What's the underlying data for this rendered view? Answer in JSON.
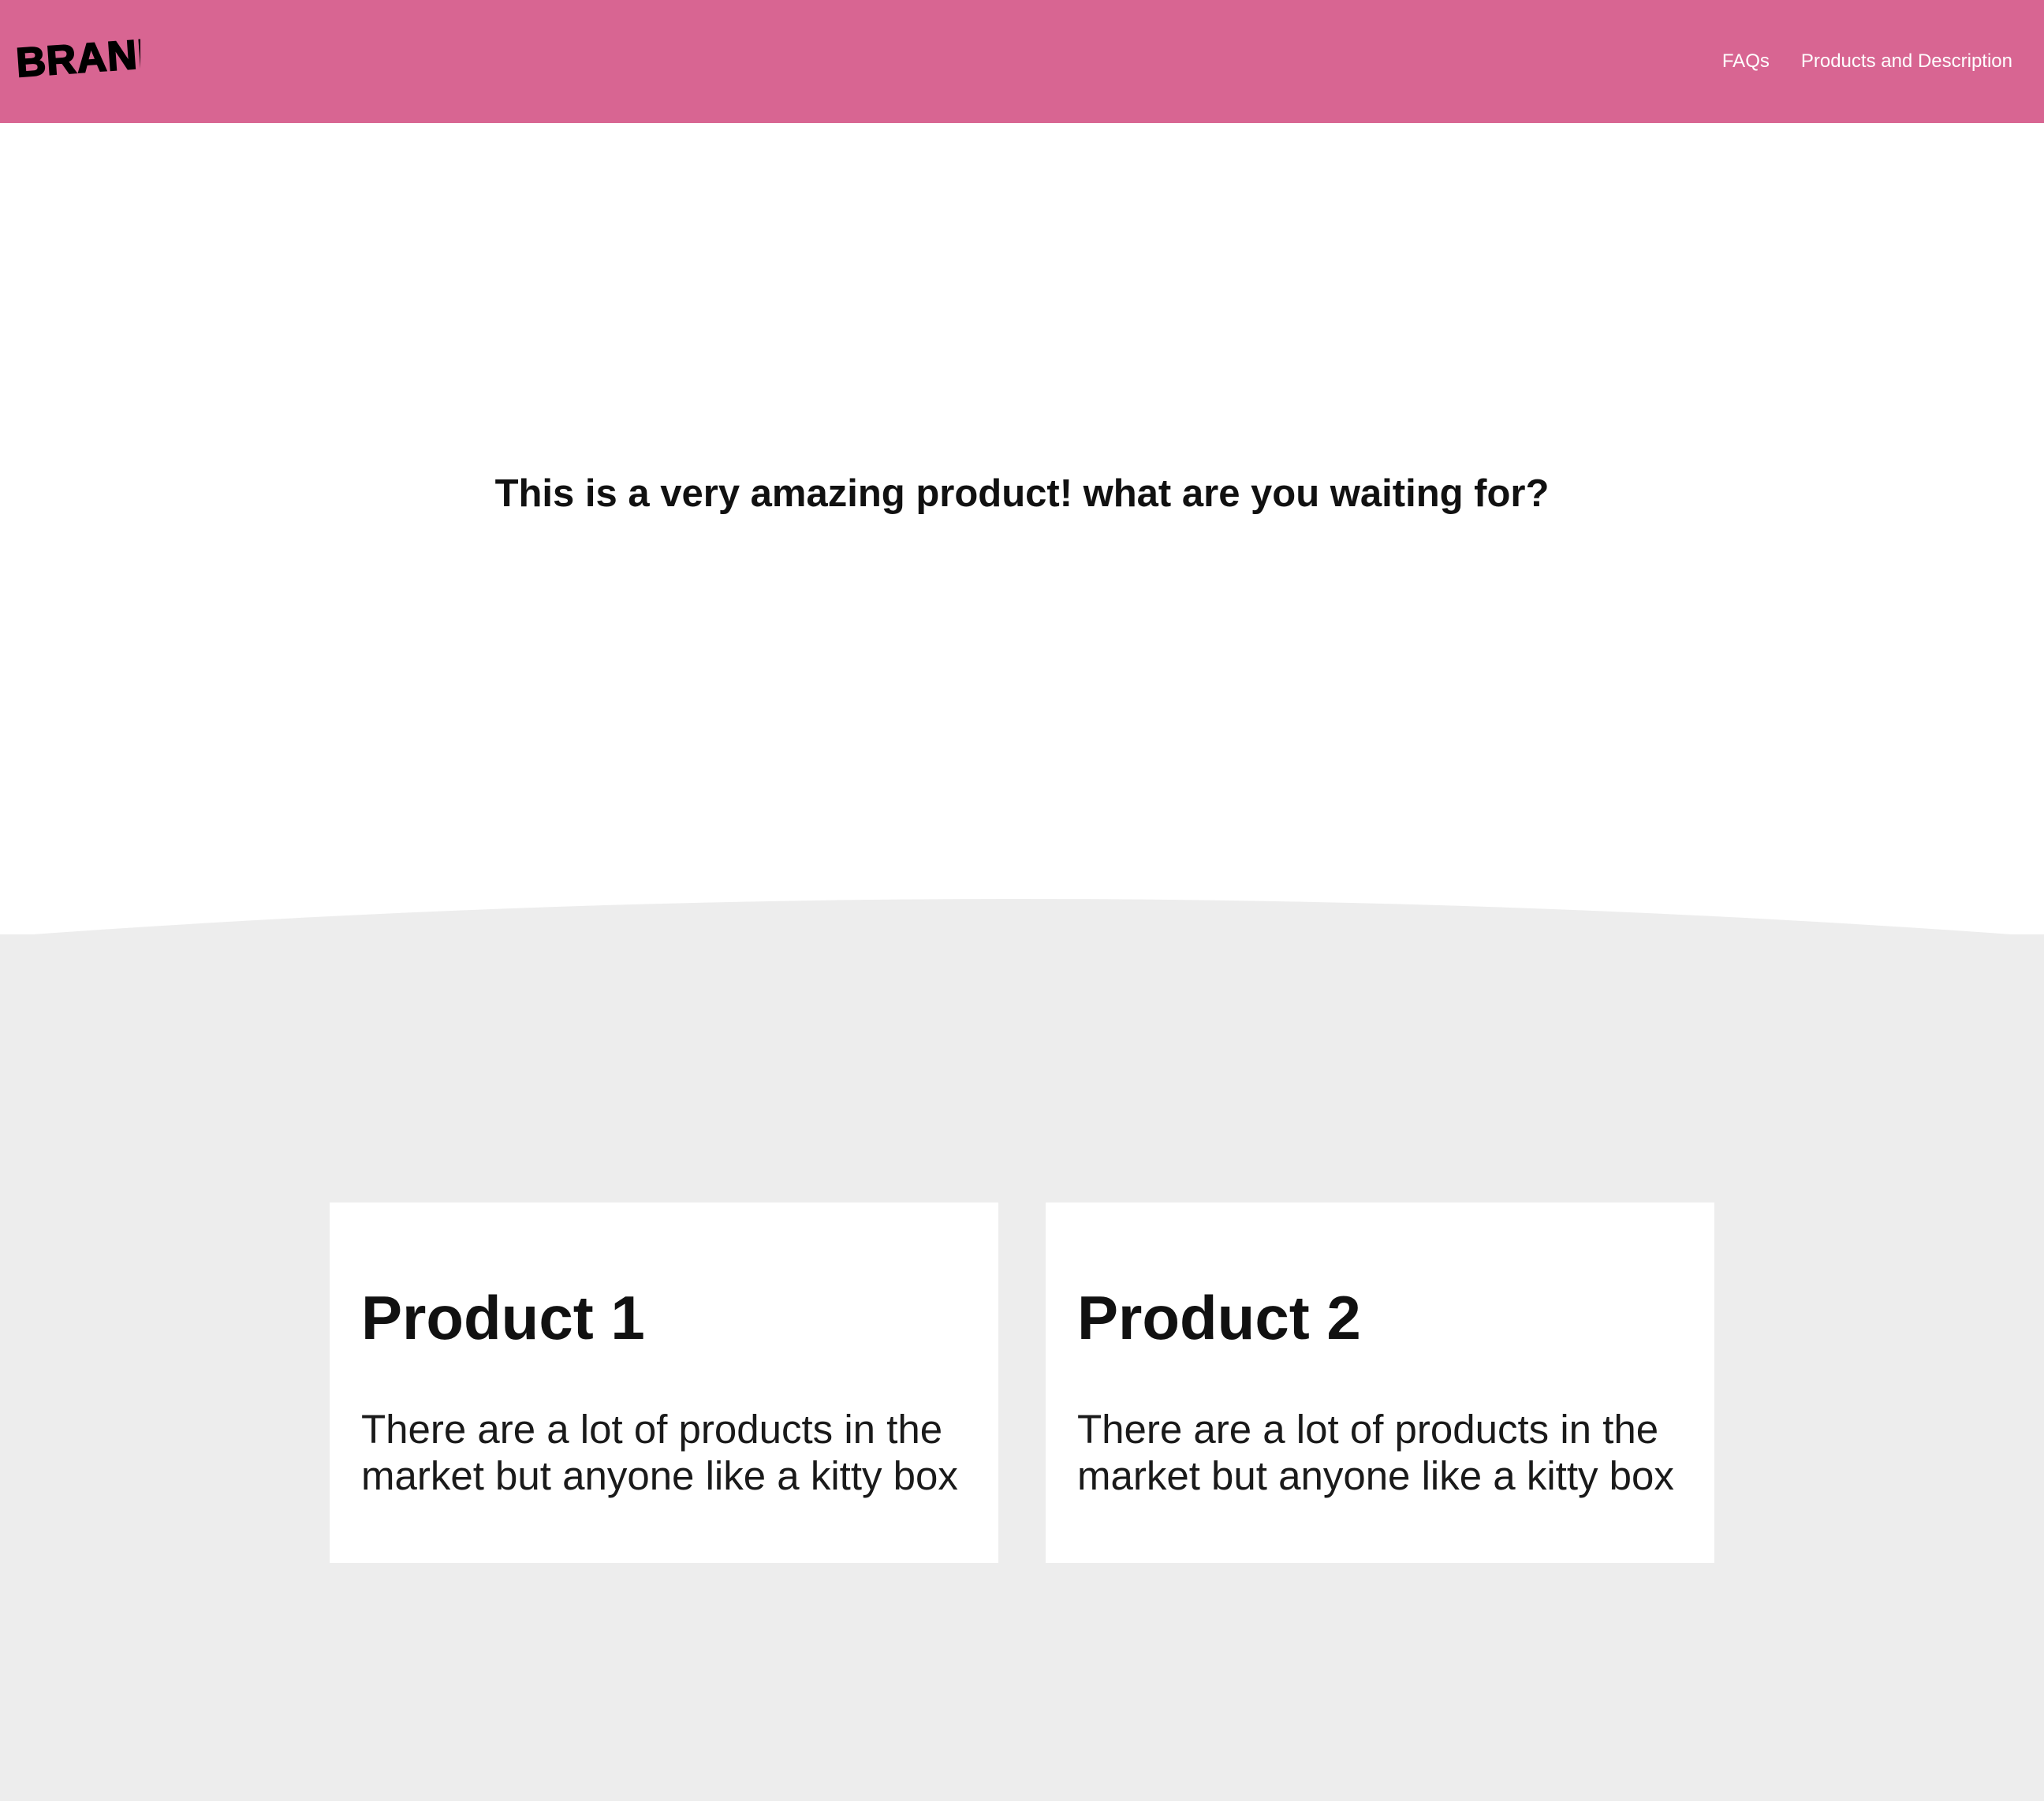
{
  "header": {
    "brand": "BRAND",
    "background_color": "#d86592",
    "nav": [
      {
        "label": "FAQs"
      },
      {
        "label": "Products and Description"
      }
    ]
  },
  "hero": {
    "title": "This is a very amazing product! what are you waiting for?"
  },
  "products": {
    "background_color": "#ededed",
    "items": [
      {
        "title": "Product 1",
        "description": "There are a lot of products in the market but anyone like a kitty box"
      },
      {
        "title": "Product 2",
        "description": "There are a lot of products in the market but anyone like a kitty box"
      }
    ]
  }
}
